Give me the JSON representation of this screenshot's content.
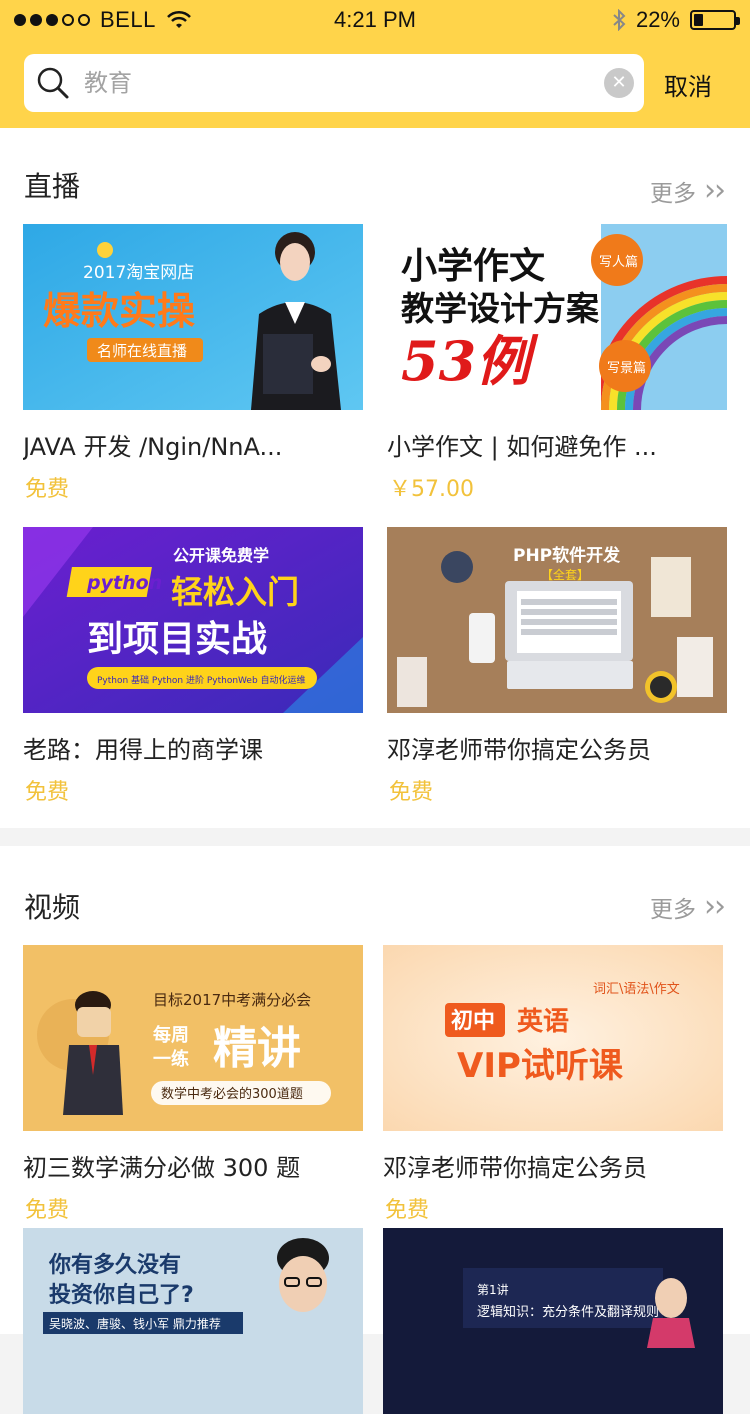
{
  "status_bar": {
    "carrier": "BELL",
    "time": "4:21 PM",
    "battery": "22%",
    "battery_level_percent": 22
  },
  "search": {
    "placeholder": "教育",
    "cancel_label": "取消"
  },
  "sections": [
    {
      "title": "直播",
      "more_label": "更多",
      "items": [
        {
          "title": "JAVA 开发 /Ngin/NnA...",
          "price": "免费",
          "thumb_text": [
            "2017淘宝网店",
            "爆款实操",
            "名师在线直播"
          ]
        },
        {
          "title": "小学作文 | 如何避免作 ...",
          "price": "￥57.00",
          "thumb_text": [
            "小学作文",
            "教学设计方案",
            "53例",
            "写人篇",
            "写景篇"
          ]
        },
        {
          "title": "老路：用得上的商学课",
          "price": "免费",
          "thumb_text": [
            "公开课免费学",
            "python",
            "轻松入门",
            "到项目实战",
            "Python 基础 Python 进阶 PythonWeb 自动化运维"
          ]
        },
        {
          "title": "邓淳老师带你搞定公务员",
          "price": "免费",
          "thumb_text": [
            "PHP软件开发",
            "【全套】"
          ]
        }
      ]
    },
    {
      "title": "视频",
      "more_label": "更多",
      "items": [
        {
          "title": "初三数学满分必做 300 题",
          "price": "免费",
          "thumb_text": [
            "目标2017中考满分必会",
            "每周",
            "一练",
            "精讲",
            "数学中考必会的300道题"
          ]
        },
        {
          "title": "邓淳老师带你搞定公务员",
          "price": "免费",
          "thumb_text": [
            "词汇\\语法\\作文",
            "初中",
            "英语",
            "VIP试听课"
          ]
        },
        {
          "title": "",
          "price": "",
          "thumb_text": [
            "你有多久没有",
            "投资你自己了?",
            "吴晓波、唐骏、钱小军 鼎力推荐"
          ]
        },
        {
          "title": "",
          "price": "",
          "thumb_text": [
            "第1讲",
            "逻辑知识：充分条件及翻译规则"
          ]
        }
      ]
    }
  ],
  "colors": {
    "accent": "#ffd44a",
    "price": "#f2c23b"
  }
}
